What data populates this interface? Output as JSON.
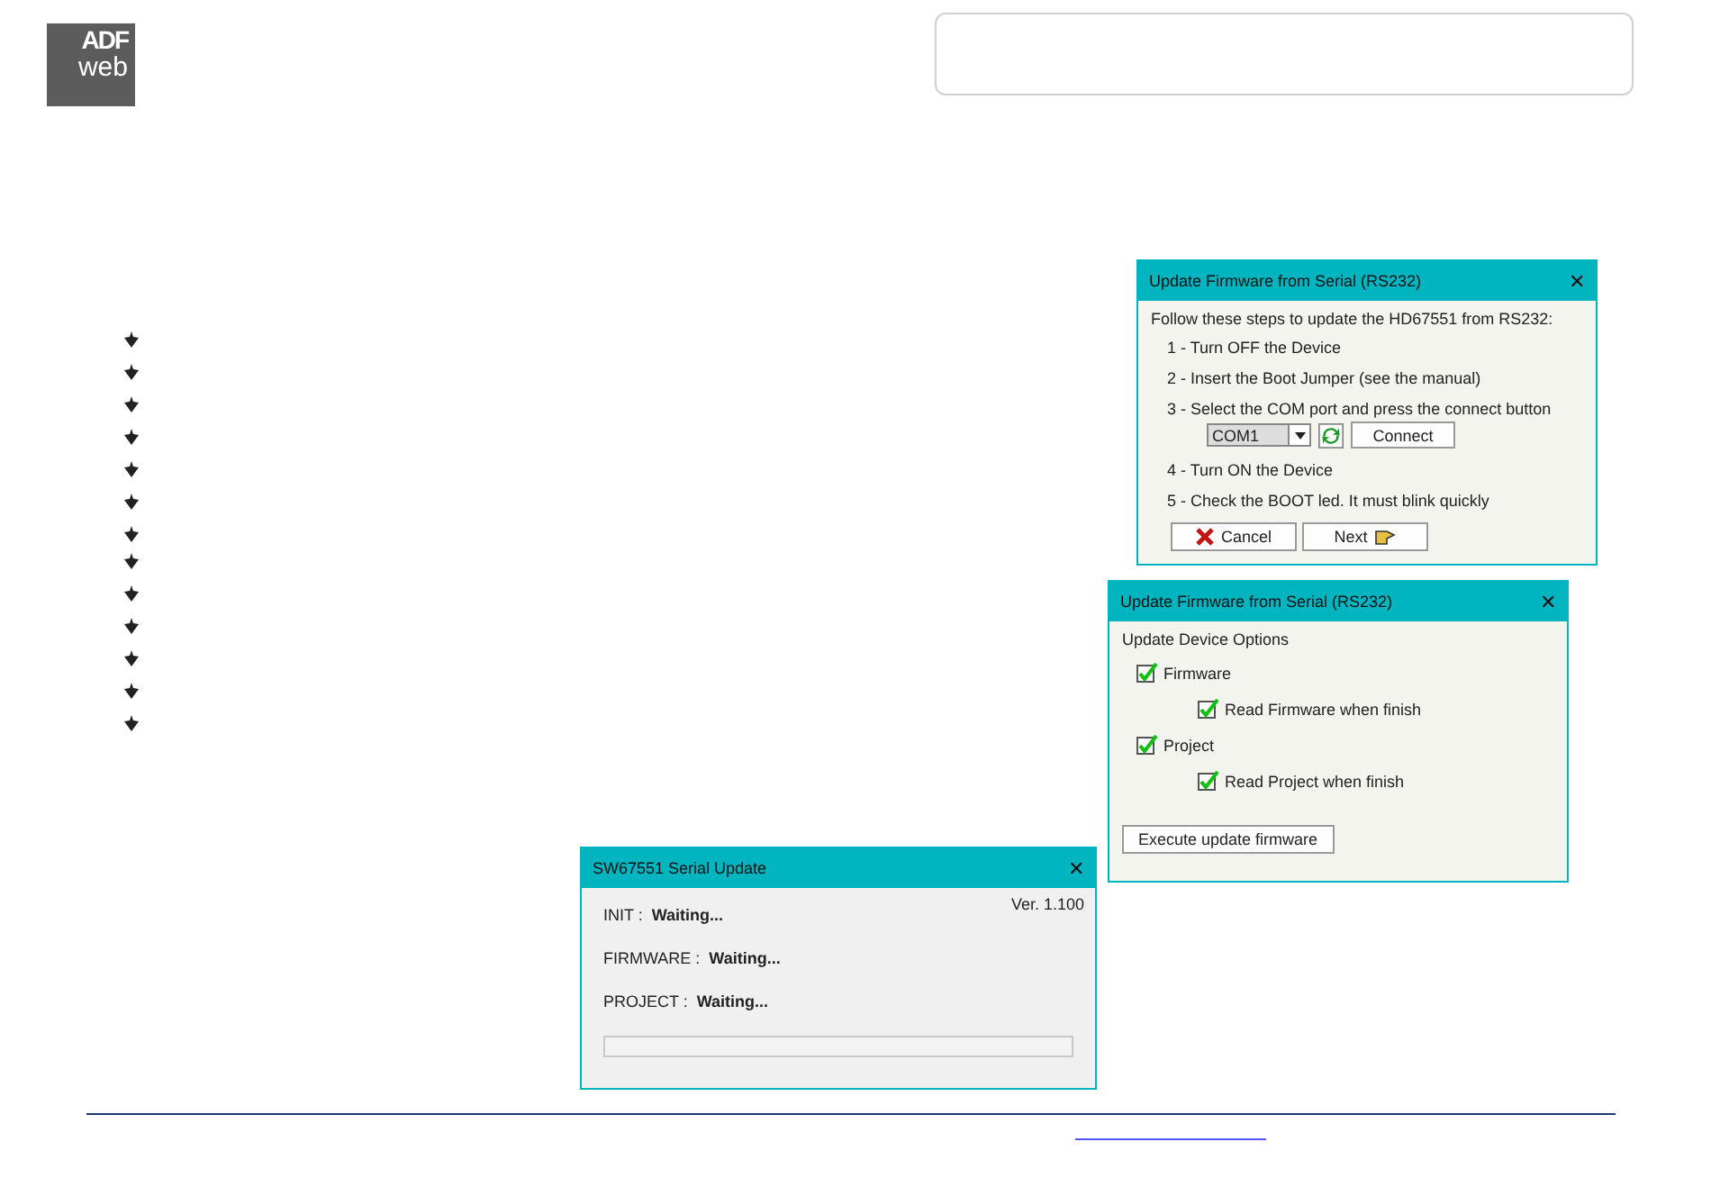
{
  "logo": {
    "top": "ADF",
    "bottom": "web"
  },
  "connect_dialog": {
    "title": "Update Firmware from Serial (RS232)",
    "close": "✕",
    "intro": "Follow these steps to update the HD67551 from RS232:",
    "steps": [
      {
        "kind": "text",
        "text": "1 - Turn OFF the Device"
      },
      {
        "kind": "text",
        "text": "2 - Insert the Boot Jumper (see the manual)"
      },
      {
        "kind": "port",
        "text": "3 - Select the  COM port and press the connect button",
        "port": "COM1",
        "button": "Connect"
      },
      {
        "kind": "text",
        "text": "4 - Turn ON the Device"
      },
      {
        "kind": "text",
        "text": "5 - Check the BOOT led. It must blink quickly"
      }
    ],
    "buttons": [
      {
        "kind": "cancel",
        "label": "Cancel"
      },
      {
        "kind": "next",
        "label": "Next"
      }
    ]
  },
  "options_dialog": {
    "title": "Update Firmware from Serial (RS232)",
    "close": "✕",
    "heading": "Update Device Options",
    "options": [
      {
        "label": "Firmware",
        "checked": true,
        "children": [
          {
            "label": "Read Firmware when finish",
            "checked": true
          }
        ]
      },
      {
        "label": "Project",
        "checked": true,
        "children": [
          {
            "label": "Read Project when finish",
            "checked": true
          }
        ]
      }
    ],
    "button": "Execute update firmware"
  },
  "update_dialog": {
    "title": "SW67551 Serial Update",
    "close": "✕",
    "version": "Ver. 1.100",
    "rows": [
      {
        "label": "INIT :",
        "value": "Waiting..."
      },
      {
        "label": "FIRMWARE :",
        "value": "Waiting..."
      },
      {
        "label": "PROJECT :",
        "value": "Waiting..."
      }
    ],
    "progress": {
      "level": 0
    }
  }
}
